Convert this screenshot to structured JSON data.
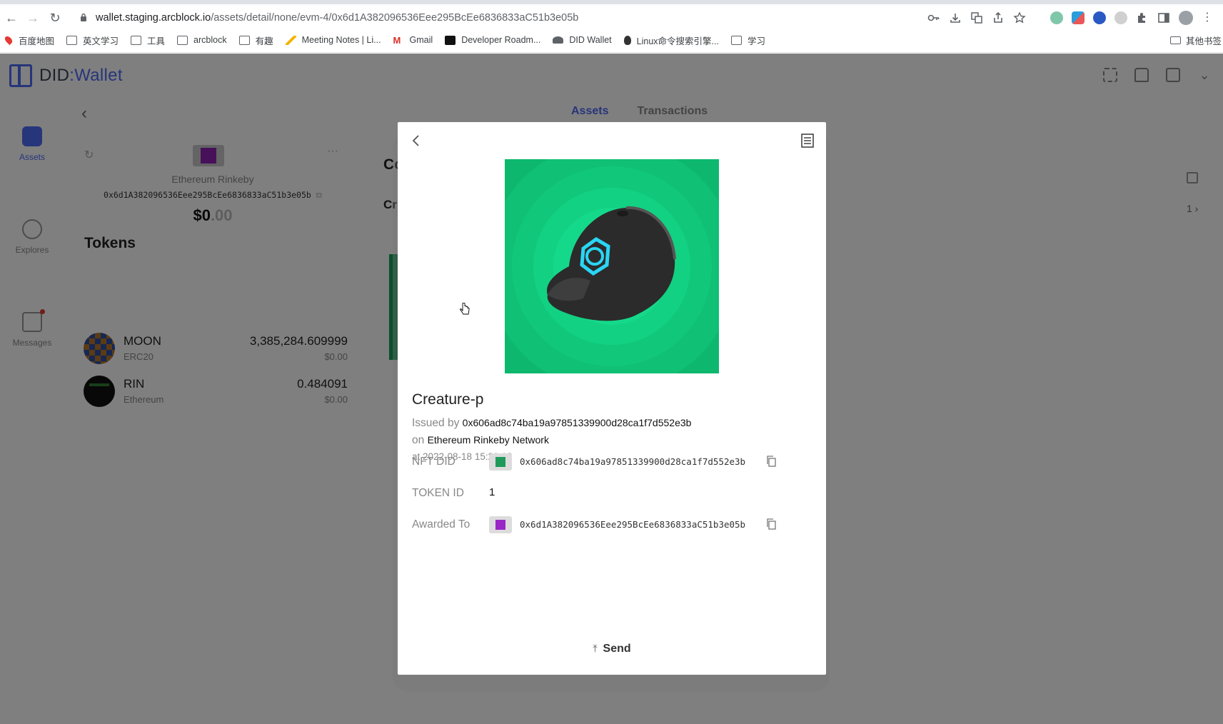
{
  "browser": {
    "url_host": "wallet.staging.arcblock.io",
    "url_path": "/assets/detail/none/evm-4/0x6d1A382096536Eee295BcEe6836833aC51b3e05b",
    "bookmarks": [
      "百度地图",
      "英文学习",
      "工具",
      "arcblock",
      "有趣",
      "Meeting Notes | Li...",
      "Gmail",
      "Developer Roadm...",
      "DID Wallet",
      "Linux命令搜索引擎...",
      "学习"
    ],
    "bookmarks_other": "其他书签"
  },
  "app": {
    "logo_prefix": "DID",
    "logo_sep": ":",
    "logo_suffix": "Wallet",
    "sidebar": [
      {
        "label": "Assets"
      },
      {
        "label": "Explores"
      },
      {
        "label": "Messages"
      }
    ],
    "wallet": {
      "chain": "Ethereum Rinkeby",
      "address": "0x6d1A382096536Eee295BcEe6836833aC51b3e05b",
      "balance_int": "$0",
      "balance_dec": ".00"
    },
    "tokens_title": "Tokens",
    "tokens": [
      {
        "name": "MOON",
        "sub": "ERC20",
        "balance": "3,385,284.609999",
        "usd": "$0.00"
      },
      {
        "name": "RIN",
        "sub": "Ethereum",
        "balance": "0.484091",
        "usd": "$0.00"
      }
    ],
    "bg_tabs": [
      "Assets",
      "Transactions"
    ],
    "bg_partial_1": "Co",
    "bg_partial_2": "Cr",
    "bg_page": "1"
  },
  "modal": {
    "title": "Creature-p",
    "issued_label": "Issued by",
    "issued_value": "0x606ad8c74ba19a97851339900d28ca1f7d552e3b",
    "on_label": "on",
    "on_value": "Ethereum Rinkeby Network",
    "at_text": "at 2022-08-18 15:29:12",
    "nft_did_label": "NFT DID",
    "nft_did_value": "0x606ad8c74ba19a97851339900d28ca1f7d552e3b",
    "token_id_label": "TOKEN ID",
    "token_id_value": "1",
    "awarded_label": "Awarded To",
    "awarded_value": "0x6d1A382096536Eee295BcEe6836833aC51b3e05b",
    "send_label": "Send"
  },
  "colors": {
    "accent": "#4f6af5",
    "nft_bg": "#0fc57a"
  }
}
